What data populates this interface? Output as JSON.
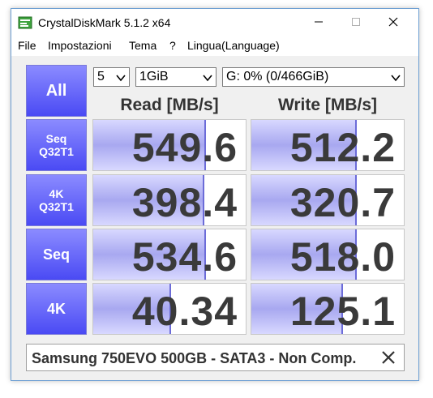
{
  "window": {
    "title": "CrystalDiskMark 5.1.2 x64",
    "minimize": "—",
    "maximize": "☐"
  },
  "menu": [
    "File",
    "Impostazioni",
    "Tema",
    "?",
    "Lingua(Language)"
  ],
  "controls": {
    "all_label": "All",
    "count": "5",
    "size": "1GiB",
    "drive": "G: 0% (0/466GiB)"
  },
  "headers": {
    "read": "Read [MB/s]",
    "write": "Write [MB/s]"
  },
  "rows": [
    {
      "label_line1": "Seq",
      "label_line2": "Q32T1",
      "read": "549.6",
      "write": "512.2",
      "read_fill": 0.74,
      "write_fill": 0.69
    },
    {
      "label_line1": "4K",
      "label_line2": "Q32T1",
      "read": "398.4",
      "write": "320.7",
      "read_fill": 0.73,
      "write_fill": 0.69
    },
    {
      "label_line1": "Seq",
      "label_line2": "",
      "read": "534.6",
      "write": "518.0",
      "read_fill": 0.74,
      "write_fill": 0.69
    },
    {
      "label_line1": "4K",
      "label_line2": "",
      "read": "40.34",
      "write": "125.1",
      "read_fill": 0.51,
      "write_fill": 0.6
    }
  ],
  "comment": "Samsung 750EVO 500GB - SATA3 - Non Comp.",
  "colors": {
    "button_top": "#8b8bff",
    "button_bottom": "#4a4af4",
    "bar": "#a8a8f0"
  }
}
